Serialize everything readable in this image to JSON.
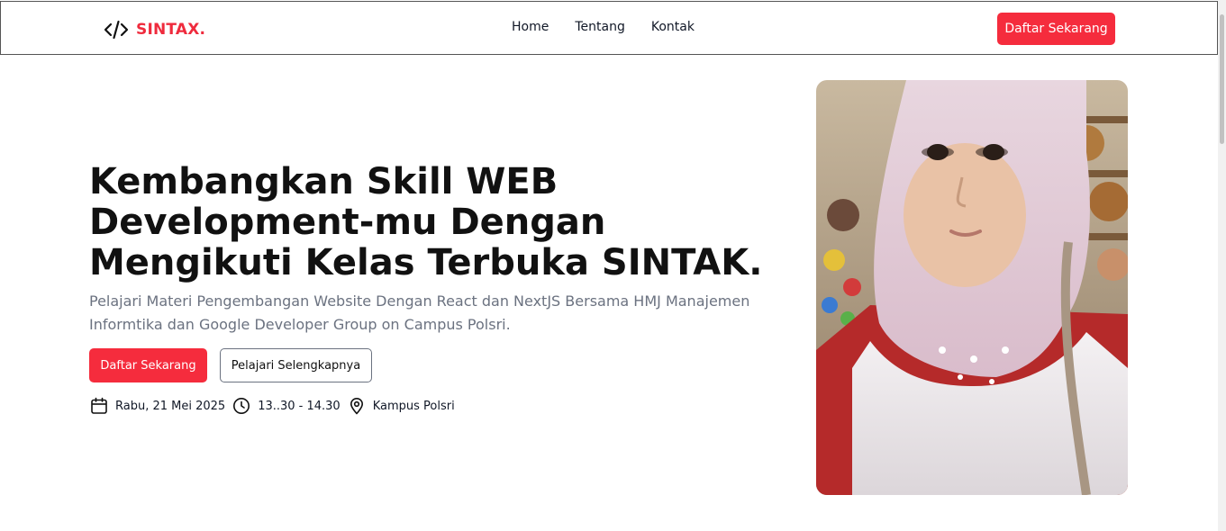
{
  "brand": {
    "name": "SINTAX.",
    "icon": "code-icon",
    "accent": "#f52c3d"
  },
  "nav": {
    "links": [
      "Home",
      "Tentang",
      "Kontak"
    ],
    "cta_label": "Daftar Sekarang"
  },
  "hero": {
    "title": "Kembangkan Skill WEB Development-mu Dengan Mengikuti Kelas Terbuka SINTAK.",
    "subtitle": "Pelajari Materi Pengembangan Website Dengan React dan NextJS Bersama HMJ Manajemen Informtika dan Google Developer Group on Campus Polsri.",
    "primary_label": "Daftar Sekarang",
    "secondary_label": "Pelajari Selengkapnya",
    "event": {
      "date": "Rabu, 21 Mei 2025",
      "time": "13..30 - 14.30",
      "location": "Kampus Polsri",
      "date_icon": "calendar-icon",
      "time_icon": "clock-icon",
      "location_icon": "map-pin-icon"
    }
  }
}
